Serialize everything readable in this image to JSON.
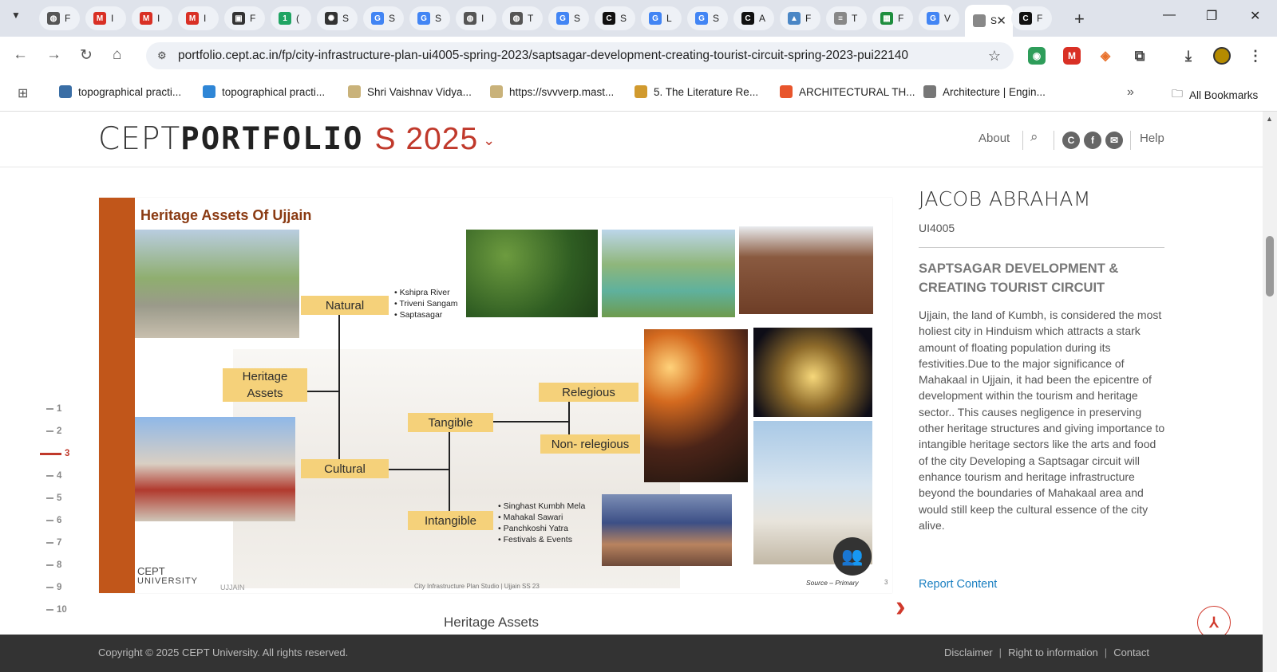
{
  "browser": {
    "tabs": [
      {
        "favicon": "globe-icon",
        "label": "F",
        "color": "#555555"
      },
      {
        "favicon": "gmail-icon",
        "label": "I",
        "color": "#d93025"
      },
      {
        "favicon": "gmail-icon",
        "label": "I",
        "color": "#d93025"
      },
      {
        "favicon": "gmail-icon",
        "label": "I",
        "color": "#d93025"
      },
      {
        "favicon": "contacts-icon",
        "label": "F",
        "color": "#333333"
      },
      {
        "favicon": "number-one-icon",
        "label": "(",
        "color": "#1fa463"
      },
      {
        "favicon": "openai-icon",
        "label": "S",
        "color": "#333333"
      },
      {
        "favicon": "google-icon",
        "label": "S",
        "color": "#4285f4"
      },
      {
        "favicon": "google-icon",
        "label": "S",
        "color": "#4285f4"
      },
      {
        "favicon": "globe-icon",
        "label": "I",
        "color": "#555555"
      },
      {
        "favicon": "globe-icon",
        "label": "T",
        "color": "#555555"
      },
      {
        "favicon": "google-icon",
        "label": "S",
        "color": "#4285f4"
      },
      {
        "favicon": "cept-icon",
        "label": "S",
        "color": "#111111"
      },
      {
        "favicon": "google-icon",
        "label": "L",
        "color": "#4285f4"
      },
      {
        "favicon": "google-icon",
        "label": "S",
        "color": "#4285f4"
      },
      {
        "favicon": "cept-icon",
        "label": "A",
        "color": "#111111"
      },
      {
        "favicon": "image-icon",
        "label": "F",
        "color": "#4a86c5"
      },
      {
        "favicon": "sheet-icon",
        "label": "T",
        "color": "#888888"
      },
      {
        "favicon": "spreadsheet-icon",
        "label": "F",
        "color": "#1e8e3e"
      },
      {
        "favicon": "google-icon",
        "label": "V",
        "color": "#4285f4"
      },
      {
        "favicon": "active-icon",
        "label": "S",
        "color": "#888888"
      },
      {
        "favicon": "cept-icon",
        "label": "F",
        "color": "#111111"
      }
    ],
    "url": "portfolio.cept.ac.in/fp/city-infrastructure-plan-ui4005-spring-2023/saptsagar-development-creating-tourist-circuit-spring-2023-pui22140",
    "bookmarks": [
      {
        "label": "topographical practi...",
        "icon": "wordpress-icon",
        "color": "#3a6ea5"
      },
      {
        "label": "topographical practi...",
        "icon": "folder-blue-icon",
        "color": "#2f86d6"
      },
      {
        "label": "Shri Vaishnav Vidya...",
        "icon": "university-seal-icon",
        "color": "#c9b27a"
      },
      {
        "label": "https://svvverp.mast...",
        "icon": "university-seal-icon",
        "color": "#c9b27a"
      },
      {
        "label": "5. The Literature Re...",
        "icon": "bookmark-t-icon",
        "color": "#d19a2e"
      },
      {
        "label": "ARCHITECTURAL TH...",
        "icon": "t-logo-icon",
        "color": "#e8552c"
      },
      {
        "label": "Architecture | Engin...",
        "icon": "building-icon",
        "color": "#777777"
      }
    ],
    "all_bookmarks": "All Bookmarks"
  },
  "site": {
    "logo_thin": "CEPT",
    "logo_bold": "PORTFOLIO",
    "semester": "S 2025",
    "nav_about": "About",
    "nav_help": "Help",
    "social": [
      "C",
      "f",
      "✉"
    ]
  },
  "pager": [
    "1",
    "2",
    "3",
    "4",
    "5",
    "6",
    "7",
    "8",
    "9",
    "10"
  ],
  "pager_active": "3",
  "slide": {
    "title": "Heritage Assets Of Ujjain",
    "chips": {
      "natural": "Natural",
      "heritage": "Heritage\nAssets",
      "cultural": "Cultural",
      "tangible": "Tangible",
      "intangible": "Intangible",
      "relegious": "Relegious",
      "non_religious": "Non- relegious"
    },
    "natural_list": [
      "Kshipra River",
      "Triveni Sangam",
      "Saptasagar"
    ],
    "intangible_list": [
      "Singhast Kumbh Mela",
      "Mahakal Sawari",
      "Panchkoshi Yatra",
      "Festivals & Events"
    ],
    "footer_logo_line1": "CEPT",
    "footer_logo_line2": "UNIVERSITY",
    "footer_logo_line3": "UJJAIN",
    "footer_mid": "City Infrastructure Plan Studio | Ujjain  SS 23",
    "footer_src": "Source – Primary",
    "page_no": "3"
  },
  "caption": "Heritage Assets",
  "panel": {
    "student": "JACOB ABRAHAM",
    "course": "UI4005",
    "project_title": "SAPTSAGAR DEVELOPMENT & CREATING TOURIST CIRCUIT",
    "description": "Ujjain, the land of Kumbh, is considered the most holiest city in Hinduism which attracts a stark amount of floating population during its festivities.Due to the major significance of Mahakaal in Ujjain, it had been the epicentre of development within the tourism and heritage sector.. This causes negligence in preserving other heritage structures and giving importance to intangible heritage sectors like the arts and food of the city  Developing a Saptsagar circuit will enhance tourism and heritage infrastructure beyond the boundaries of Mahakaal area and would still keep the cultural essence of the city alive.",
    "report": "Report Content"
  },
  "footer": {
    "copyright": "Copyright © 2025 CEPT University. All rights reserved.",
    "links": [
      "Disclaimer",
      "Right to information",
      "Contact"
    ]
  },
  "colors": {
    "accent_red": "#c0392b",
    "slide_orange": "#c1561a",
    "chip_yellow": "#f5d17a",
    "link_blue": "#1a7fc1"
  }
}
